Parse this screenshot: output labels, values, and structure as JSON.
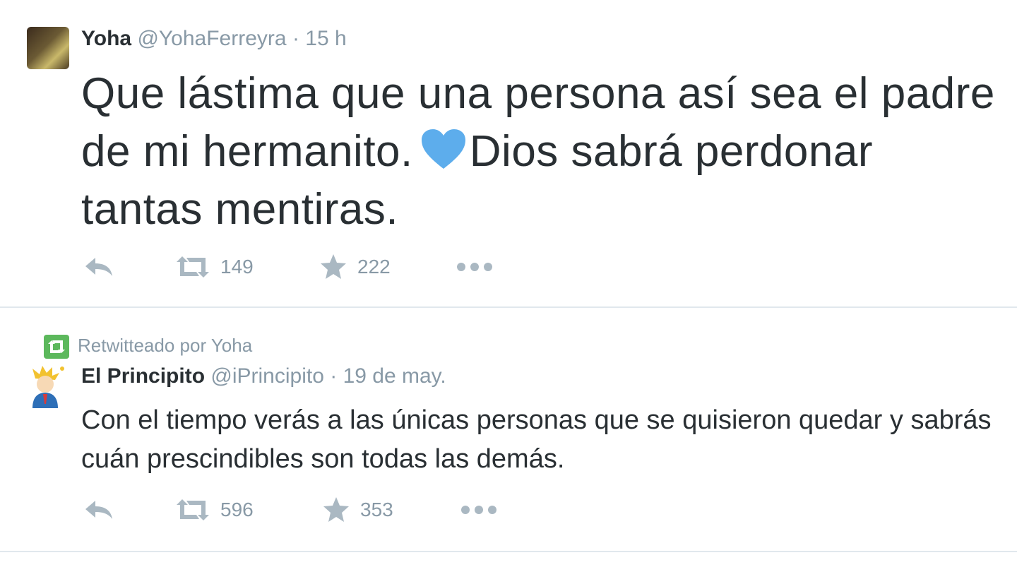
{
  "tweets": [
    {
      "fullname": "Yoha",
      "username": "@YohaFerreyra",
      "separator": "·",
      "time": "15 h",
      "text_part1": "Que lástima que una persona así sea el padre de mi hermanito.",
      "text_part2": "Dios sabrá perdonar tantas mentiras.",
      "emoji": "blue-heart-icon",
      "retweets": "149",
      "favorites": "222"
    },
    {
      "context": "Retwitteado por Yoha",
      "fullname": "El Principito",
      "username": "@iPrincipito",
      "separator": "·",
      "time": "19 de may.",
      "text": "Con el tiempo verás a las únicas personas que se quisieron quedar y sabrás cuán prescindibles son todas las demás.",
      "retweets": "596",
      "favorites": "353"
    }
  ],
  "colors": {
    "text": "#292f33",
    "meta": "#8899a6",
    "action_icon": "#aab8c2",
    "heart": "#5dadec",
    "retweet_context": "#5cb85c",
    "divider": "#e1e8ed"
  }
}
